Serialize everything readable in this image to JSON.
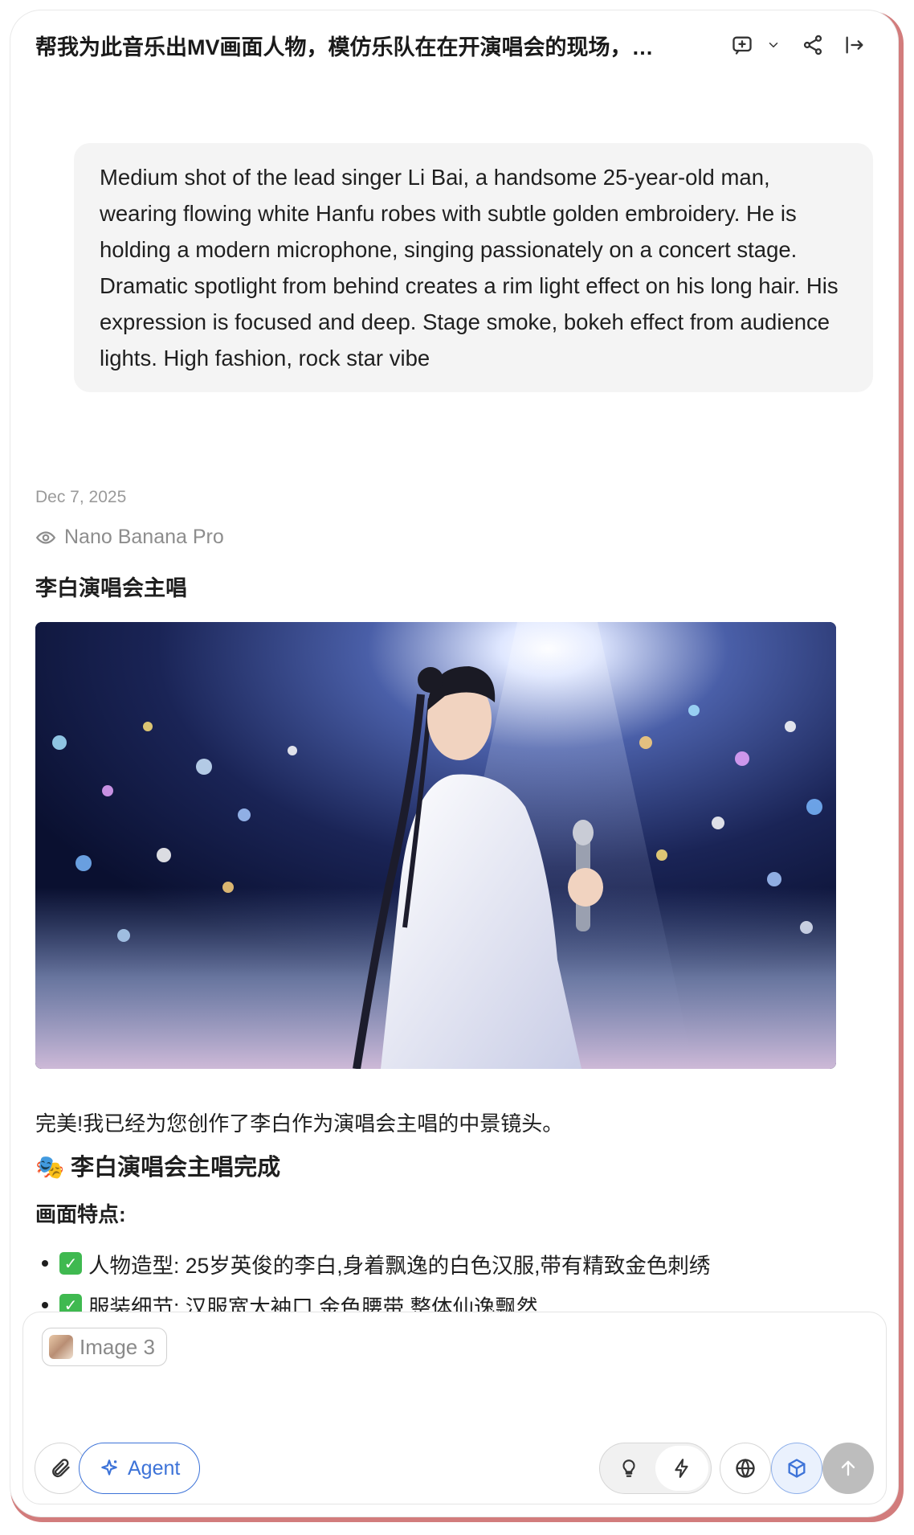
{
  "header": {
    "title": "帮我为此音乐出MV画面人物，模仿乐队在在开演唱会的现场，…",
    "icons": [
      "new-chat-icon",
      "chevron-down-icon",
      "share-icon",
      "exit-icon"
    ]
  },
  "conversation": {
    "user_prompt": "Medium shot of the lead singer Li Bai, a handsome 25-year-old man, wearing flowing white Hanfu robes with subtle golden embroidery. He is holding a modern microphone, singing passionately on a concert stage. Dramatic spotlight from behind creates a rim light effect on his long hair. His expression is focused and deep. Stage smoke, bokeh effect from audience lights. High fashion, rock star vibe",
    "date": "Dec 7, 2025",
    "model_name": "Nano Banana Pro",
    "answer_title": "李白演唱会主唱",
    "image_caption_char": "李白",
    "intro": "完美!我已经为您创作了李白作为演唱会主唱的中景镜头。",
    "section_heading": "🎭 李白演唱会主唱完成",
    "features_heading": "画面特点:",
    "features": [
      "人物造型: 25岁英俊的李白,身着飘逸的白色汉服,带有精致金色刺绣",
      "服装细节: 汉服宽大袖口,金色腰带,整体仙逸飘然"
    ]
  },
  "composer": {
    "attachment_label": "Image 3",
    "agent_label": "Agent"
  },
  "colors": {
    "accent": "#3d73d8",
    "frame": "#d27c7c",
    "bubble": "#f4f4f4",
    "muted": "#9a9a9a"
  }
}
